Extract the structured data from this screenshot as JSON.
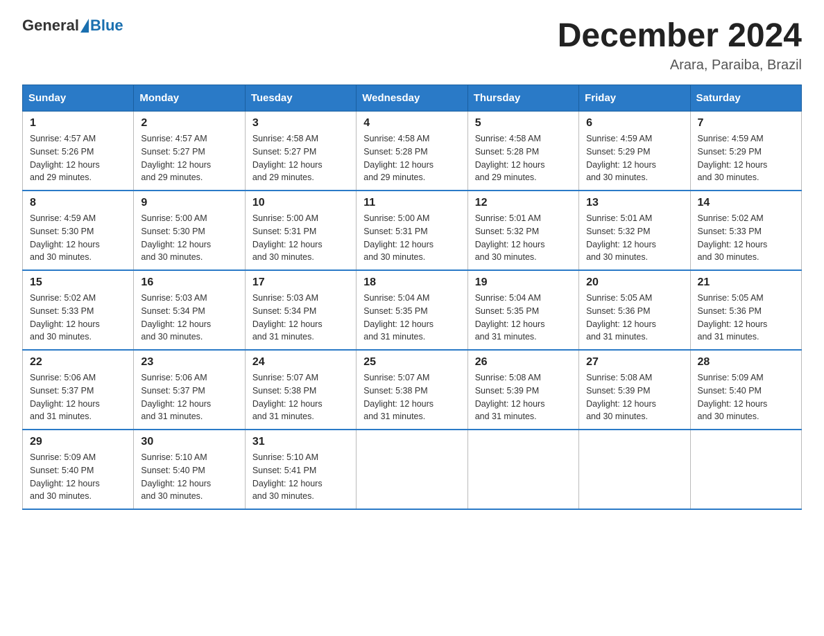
{
  "header": {
    "logo_general": "General",
    "logo_blue": "Blue",
    "month_title": "December 2024",
    "location": "Arara, Paraiba, Brazil"
  },
  "days_of_week": [
    "Sunday",
    "Monday",
    "Tuesday",
    "Wednesday",
    "Thursday",
    "Friday",
    "Saturday"
  ],
  "weeks": [
    [
      {
        "day": "1",
        "sunrise": "4:57 AM",
        "sunset": "5:26 PM",
        "daylight": "12 hours and 29 minutes."
      },
      {
        "day": "2",
        "sunrise": "4:57 AM",
        "sunset": "5:27 PM",
        "daylight": "12 hours and 29 minutes."
      },
      {
        "day": "3",
        "sunrise": "4:58 AM",
        "sunset": "5:27 PM",
        "daylight": "12 hours and 29 minutes."
      },
      {
        "day": "4",
        "sunrise": "4:58 AM",
        "sunset": "5:28 PM",
        "daylight": "12 hours and 29 minutes."
      },
      {
        "day": "5",
        "sunrise": "4:58 AM",
        "sunset": "5:28 PM",
        "daylight": "12 hours and 29 minutes."
      },
      {
        "day": "6",
        "sunrise": "4:59 AM",
        "sunset": "5:29 PM",
        "daylight": "12 hours and 30 minutes."
      },
      {
        "day": "7",
        "sunrise": "4:59 AM",
        "sunset": "5:29 PM",
        "daylight": "12 hours and 30 minutes."
      }
    ],
    [
      {
        "day": "8",
        "sunrise": "4:59 AM",
        "sunset": "5:30 PM",
        "daylight": "12 hours and 30 minutes."
      },
      {
        "day": "9",
        "sunrise": "5:00 AM",
        "sunset": "5:30 PM",
        "daylight": "12 hours and 30 minutes."
      },
      {
        "day": "10",
        "sunrise": "5:00 AM",
        "sunset": "5:31 PM",
        "daylight": "12 hours and 30 minutes."
      },
      {
        "day": "11",
        "sunrise": "5:00 AM",
        "sunset": "5:31 PM",
        "daylight": "12 hours and 30 minutes."
      },
      {
        "day": "12",
        "sunrise": "5:01 AM",
        "sunset": "5:32 PM",
        "daylight": "12 hours and 30 minutes."
      },
      {
        "day": "13",
        "sunrise": "5:01 AM",
        "sunset": "5:32 PM",
        "daylight": "12 hours and 30 minutes."
      },
      {
        "day": "14",
        "sunrise": "5:02 AM",
        "sunset": "5:33 PM",
        "daylight": "12 hours and 30 minutes."
      }
    ],
    [
      {
        "day": "15",
        "sunrise": "5:02 AM",
        "sunset": "5:33 PM",
        "daylight": "12 hours and 30 minutes."
      },
      {
        "day": "16",
        "sunrise": "5:03 AM",
        "sunset": "5:34 PM",
        "daylight": "12 hours and 30 minutes."
      },
      {
        "day": "17",
        "sunrise": "5:03 AM",
        "sunset": "5:34 PM",
        "daylight": "12 hours and 31 minutes."
      },
      {
        "day": "18",
        "sunrise": "5:04 AM",
        "sunset": "5:35 PM",
        "daylight": "12 hours and 31 minutes."
      },
      {
        "day": "19",
        "sunrise": "5:04 AM",
        "sunset": "5:35 PM",
        "daylight": "12 hours and 31 minutes."
      },
      {
        "day": "20",
        "sunrise": "5:05 AM",
        "sunset": "5:36 PM",
        "daylight": "12 hours and 31 minutes."
      },
      {
        "day": "21",
        "sunrise": "5:05 AM",
        "sunset": "5:36 PM",
        "daylight": "12 hours and 31 minutes."
      }
    ],
    [
      {
        "day": "22",
        "sunrise": "5:06 AM",
        "sunset": "5:37 PM",
        "daylight": "12 hours and 31 minutes."
      },
      {
        "day": "23",
        "sunrise": "5:06 AM",
        "sunset": "5:37 PM",
        "daylight": "12 hours and 31 minutes."
      },
      {
        "day": "24",
        "sunrise": "5:07 AM",
        "sunset": "5:38 PM",
        "daylight": "12 hours and 31 minutes."
      },
      {
        "day": "25",
        "sunrise": "5:07 AM",
        "sunset": "5:38 PM",
        "daylight": "12 hours and 31 minutes."
      },
      {
        "day": "26",
        "sunrise": "5:08 AM",
        "sunset": "5:39 PM",
        "daylight": "12 hours and 31 minutes."
      },
      {
        "day": "27",
        "sunrise": "5:08 AM",
        "sunset": "5:39 PM",
        "daylight": "12 hours and 30 minutes."
      },
      {
        "day": "28",
        "sunrise": "5:09 AM",
        "sunset": "5:40 PM",
        "daylight": "12 hours and 30 minutes."
      }
    ],
    [
      {
        "day": "29",
        "sunrise": "5:09 AM",
        "sunset": "5:40 PM",
        "daylight": "12 hours and 30 minutes."
      },
      {
        "day": "30",
        "sunrise": "5:10 AM",
        "sunset": "5:40 PM",
        "daylight": "12 hours and 30 minutes."
      },
      {
        "day": "31",
        "sunrise": "5:10 AM",
        "sunset": "5:41 PM",
        "daylight": "12 hours and 30 minutes."
      },
      null,
      null,
      null,
      null
    ]
  ],
  "labels": {
    "sunrise": "Sunrise:",
    "sunset": "Sunset:",
    "daylight": "Daylight:"
  }
}
